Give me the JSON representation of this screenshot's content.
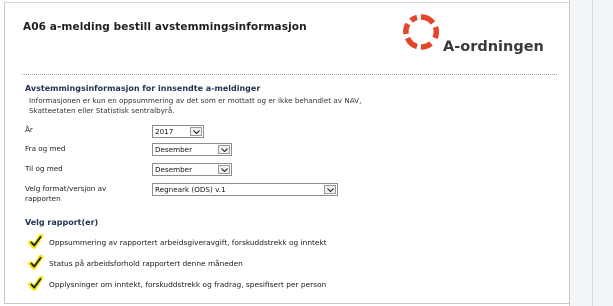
{
  "header": {
    "title": "A06 a-melding bestill avstemmingsinformasjon",
    "logo_text": "A-ordningen",
    "logo_icon": "nav-logo-icon"
  },
  "section": {
    "heading": "Avstemmingsinformasjon for innsendte a-meldinger",
    "info": "Informasjonen er kun en oppsummering av det som er mottatt og er ikke behandlet av NAV, Skatteetaten eller Statistisk sentralbyrå."
  },
  "form": {
    "year_label": "År",
    "year_value": "2017",
    "from_label": "Fra og med",
    "from_value": "Desember",
    "to_label": "Til og med",
    "to_value": "Desember",
    "format_label": "Velg format/versjon av rapporten",
    "format_value": "Regneark (ODS) v.1"
  },
  "reports": {
    "heading": "Velg rapport(er)",
    "items": [
      {
        "label": "Oppsummering av rapportert arbeidsgiveravgift, forskuddstrekk og inntekt",
        "checked": true
      },
      {
        "label": "Status på arbeidsforhold rapportert denne måneden",
        "checked": true
      },
      {
        "label": "Opplysninger om inntekt, forskuddstrekk og fradrag, spesifisert per person",
        "checked": true
      }
    ]
  },
  "colors": {
    "highlight": "#f2e600",
    "logo_red": "#e2452a",
    "heading_blue": "#1f3350"
  }
}
